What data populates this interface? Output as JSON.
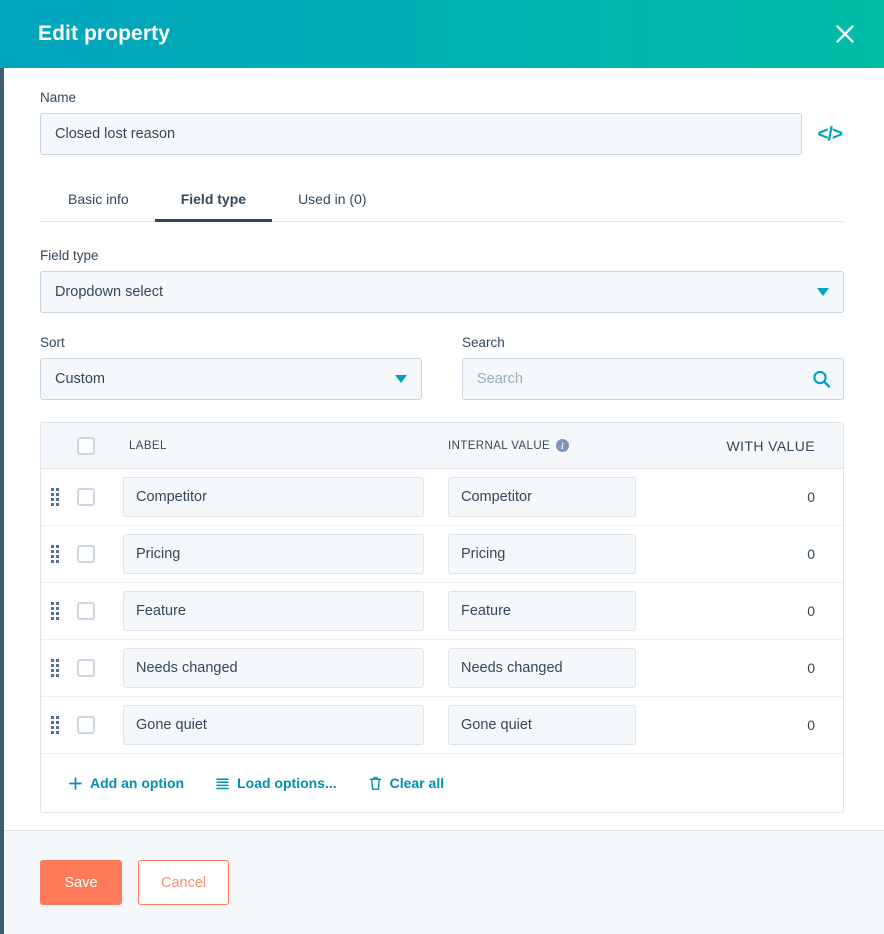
{
  "header": {
    "title": "Edit property",
    "close_icon": "close-icon",
    "gradient_from": "#00a4bd",
    "gradient_to": "#00bda5"
  },
  "name_field": {
    "label": "Name",
    "value": "Closed lost reason",
    "placeholder": "Name",
    "code_icon": "</>"
  },
  "tabs": [
    {
      "label": "Basic info",
      "active": false
    },
    {
      "label": "Field type",
      "active": true
    },
    {
      "label": "Used in (0)",
      "active": false
    }
  ],
  "field_type": {
    "label": "Field type",
    "value": "Dropdown select"
  },
  "sort": {
    "label": "Sort",
    "value": "Custom"
  },
  "search": {
    "label": "Search",
    "value": "",
    "placeholder": "Search",
    "icon": "search-icon"
  },
  "options_table": {
    "columns": {
      "label": "LABEL",
      "internal_value": "INTERNAL VALUE",
      "with_value": "WITH VALUE",
      "info_glyph": "i"
    },
    "rows": [
      {
        "label": "Competitor",
        "internal_value": "Competitor",
        "with_value": "0",
        "checked": false
      },
      {
        "label": "Pricing",
        "internal_value": "Pricing",
        "with_value": "0",
        "checked": false
      },
      {
        "label": "Feature",
        "internal_value": "Feature",
        "with_value": "0",
        "checked": false
      },
      {
        "label": "Needs changed",
        "internal_value": "Needs changed",
        "with_value": "0",
        "checked": false
      },
      {
        "label": "Gone quiet",
        "internal_value": "Gone quiet",
        "with_value": "0",
        "checked": false
      }
    ],
    "actions": [
      {
        "label": "Add an option",
        "icon": "plus-icon"
      },
      {
        "label": "Load options...",
        "icon": "list-icon"
      },
      {
        "label": "Clear all",
        "icon": "trash-icon"
      }
    ]
  },
  "footer": {
    "save_label": "Save",
    "cancel_label": "Cancel",
    "save_color": "#ff7a59"
  }
}
